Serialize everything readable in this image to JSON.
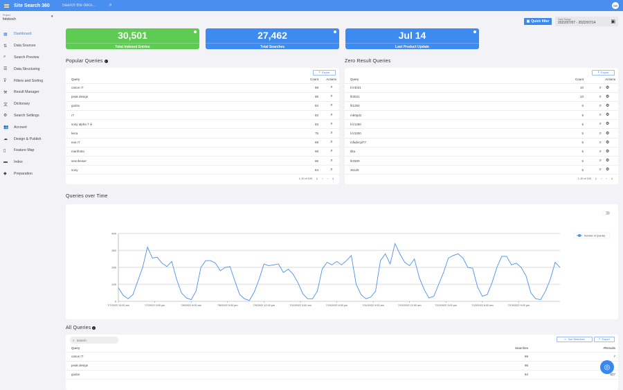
{
  "topbar": {
    "brand": "Site Search 360",
    "search_placeholder": "Search the docs...",
    "avatar": "SB"
  },
  "project": {
    "label": "Project",
    "value": "fotokoch"
  },
  "sidebar": {
    "items": [
      {
        "label": "Dashboard",
        "icon": "dashboard-icon",
        "glyph": "▦",
        "active": true
      },
      {
        "label": "Data Sources",
        "icon": "swap-vert-icon",
        "glyph": "⇅"
      },
      {
        "label": "Search Preview",
        "icon": "search-icon",
        "glyph": "⌕"
      },
      {
        "label": "Data Structuring",
        "icon": "structure-icon",
        "glyph": "☰"
      },
      {
        "label": "Filters and Sorting",
        "icon": "filter-icon",
        "glyph": "⊽"
      },
      {
        "label": "Result Manager",
        "icon": "tools-icon",
        "glyph": "⚒"
      },
      {
        "label": "Dictionary",
        "icon": "translate-icon",
        "glyph": "文"
      },
      {
        "label": "Search Settings",
        "icon": "gear-icon",
        "glyph": "⚙"
      },
      {
        "label": "Account",
        "icon": "account-icon",
        "glyph": "👥"
      },
      {
        "label": "Design & Publish",
        "icon": "cloud-upload-icon",
        "glyph": "☁"
      },
      {
        "label": "Feature Map",
        "icon": "map-icon",
        "glyph": "▯"
      },
      {
        "label": "Index",
        "icon": "folder-icon",
        "glyph": "▬"
      },
      {
        "label": "Preparation",
        "icon": "tag-icon",
        "glyph": "◆"
      }
    ]
  },
  "filters": {
    "quick_filter": "Quick filter",
    "date_range_label": "Date Range",
    "date_range_value": "2022/07/07 - 2022/07/14"
  },
  "cards": [
    {
      "value": "30,501",
      "label": "Total Indexed Entries",
      "color": "#5ecb52"
    },
    {
      "value": "27,462",
      "label": "Total Searches",
      "color": "#3d8af0"
    },
    {
      "value": "Jul 14",
      "label": "Last Product Update",
      "color": "#3d8af0"
    }
  ],
  "popular": {
    "title": "Popular Queries",
    "export": "Export",
    "headers": [
      "Query",
      "Count",
      "Actions"
    ],
    "rows": [
      [
        "canon r7",
        "89"
      ],
      [
        "peak design",
        "86"
      ],
      [
        "godox",
        "84"
      ],
      [
        "r7",
        "83"
      ],
      [
        "sony alpha 7 iii",
        "83"
      ],
      [
        "leica",
        "75"
      ],
      [
        "eos r7",
        "69"
      ],
      [
        "manfrotto",
        "68"
      ],
      [
        "sennheiser",
        "66"
      ],
      [
        "sony",
        "64"
      ]
    ],
    "pager": "1-10 of 100"
  },
  "zero": {
    "title": "Zero Result Queries",
    "export": "Export",
    "headers": [
      "Query",
      "Count",
      "Actions"
    ],
    "rows": [
      [
        "li lr3031",
        "10"
      ],
      [
        "llr3031",
        "10"
      ],
      [
        "llr1250",
        "6"
      ],
      [
        "mb0pd1",
        "6"
      ],
      [
        "li lr1250",
        "6"
      ],
      [
        "li lr3300",
        "5"
      ],
      [
        "mfadvcpl77",
        "5"
      ],
      [
        "tilta",
        "5"
      ],
      [
        "llr3300",
        "5"
      ],
      [
        "45125",
        "5"
      ]
    ],
    "pager": "1-10 of 100"
  },
  "chart_section": {
    "title": "Queries over Time"
  },
  "chart_data": {
    "type": "line",
    "title": "Queries over Time",
    "xlabel": "",
    "ylabel": "",
    "ylim": [
      0,
      400
    ],
    "yticks": [
      0,
      100,
      200,
      300,
      400
    ],
    "grid": true,
    "legend": "right",
    "series": [
      {
        "name": "Number of Queries",
        "color": "#4a8ff0"
      }
    ],
    "x_hours_from_start": [
      0,
      2,
      4,
      6,
      8,
      10,
      12,
      14,
      16,
      18,
      20,
      22,
      24,
      26,
      28,
      30,
      32,
      34,
      36,
      38,
      40,
      42,
      44,
      46,
      48,
      50,
      52,
      54,
      56,
      58,
      60,
      62,
      64,
      66,
      68,
      70,
      72,
      74,
      76,
      78,
      80,
      82,
      84,
      86,
      88,
      90,
      92,
      94,
      96,
      98,
      100,
      102,
      104,
      106,
      108,
      110,
      112,
      114,
      116,
      118,
      120,
      122,
      124,
      126,
      128,
      130,
      132,
      134,
      136,
      138,
      140,
      142,
      144,
      146,
      148,
      150,
      152,
      154,
      156,
      158,
      160,
      162,
      164,
      166,
      168,
      170,
      172,
      174,
      176,
      178,
      180,
      182
    ],
    "values": [
      80,
      35,
      15,
      40,
      120,
      200,
      320,
      255,
      260,
      225,
      205,
      235,
      130,
      50,
      20,
      10,
      60,
      200,
      240,
      240,
      225,
      180,
      200,
      205,
      120,
      40,
      15,
      5,
      55,
      130,
      220,
      210,
      215,
      220,
      170,
      190,
      160,
      110,
      45,
      15,
      15,
      60,
      190,
      230,
      215,
      235,
      215,
      240,
      270,
      100,
      40,
      15,
      25,
      60,
      240,
      280,
      220,
      340,
      280,
      230,
      210,
      250,
      140,
      70,
      20,
      30,
      100,
      170,
      255,
      270,
      280,
      255,
      200,
      195,
      85,
      30,
      40,
      110,
      200,
      265,
      265,
      215,
      225,
      200,
      150,
      50,
      15,
      10,
      60,
      130,
      230,
      200
    ],
    "x_ticks": [
      {
        "h": 0,
        "label": "7/7/2022 12:00 am"
      },
      {
        "h": 15,
        "label": "7/7/2022 3:00 pm"
      },
      {
        "h": 30,
        "label": "7/8/2022 6:00 am"
      },
      {
        "h": 45,
        "label": "7/8/2022 9:00 pm"
      },
      {
        "h": 60,
        "label": "7/9/2022 12:00 pm"
      },
      {
        "h": 75,
        "label": "7/10/2022 3:00 am"
      },
      {
        "h": 90,
        "label": "7/10/2022 6:00 pm"
      },
      {
        "h": 105,
        "label": "7/11/2022 9:00 am"
      },
      {
        "h": 120,
        "label": "7/12/2022 12:00 am"
      },
      {
        "h": 135,
        "label": "7/12/2022 3:00 pm"
      },
      {
        "h": 150,
        "label": "7/13/2022 6:00 am"
      },
      {
        "h": 165,
        "label": "7/13/2022 9:00 pm"
      }
    ],
    "x_range_hours": [
      0,
      182
    ]
  },
  "all": {
    "title": "All Queries",
    "search_placeholder": "Search",
    "sort": "Sort Searches",
    "export": "Export",
    "headers": [
      "Query",
      "Searches",
      "#Results"
    ],
    "rows": [
      [
        "canon r7",
        "89",
        "7"
      ],
      [
        "peak design",
        "86",
        ""
      ],
      [
        "godox",
        "84",
        "827"
      ]
    ]
  }
}
